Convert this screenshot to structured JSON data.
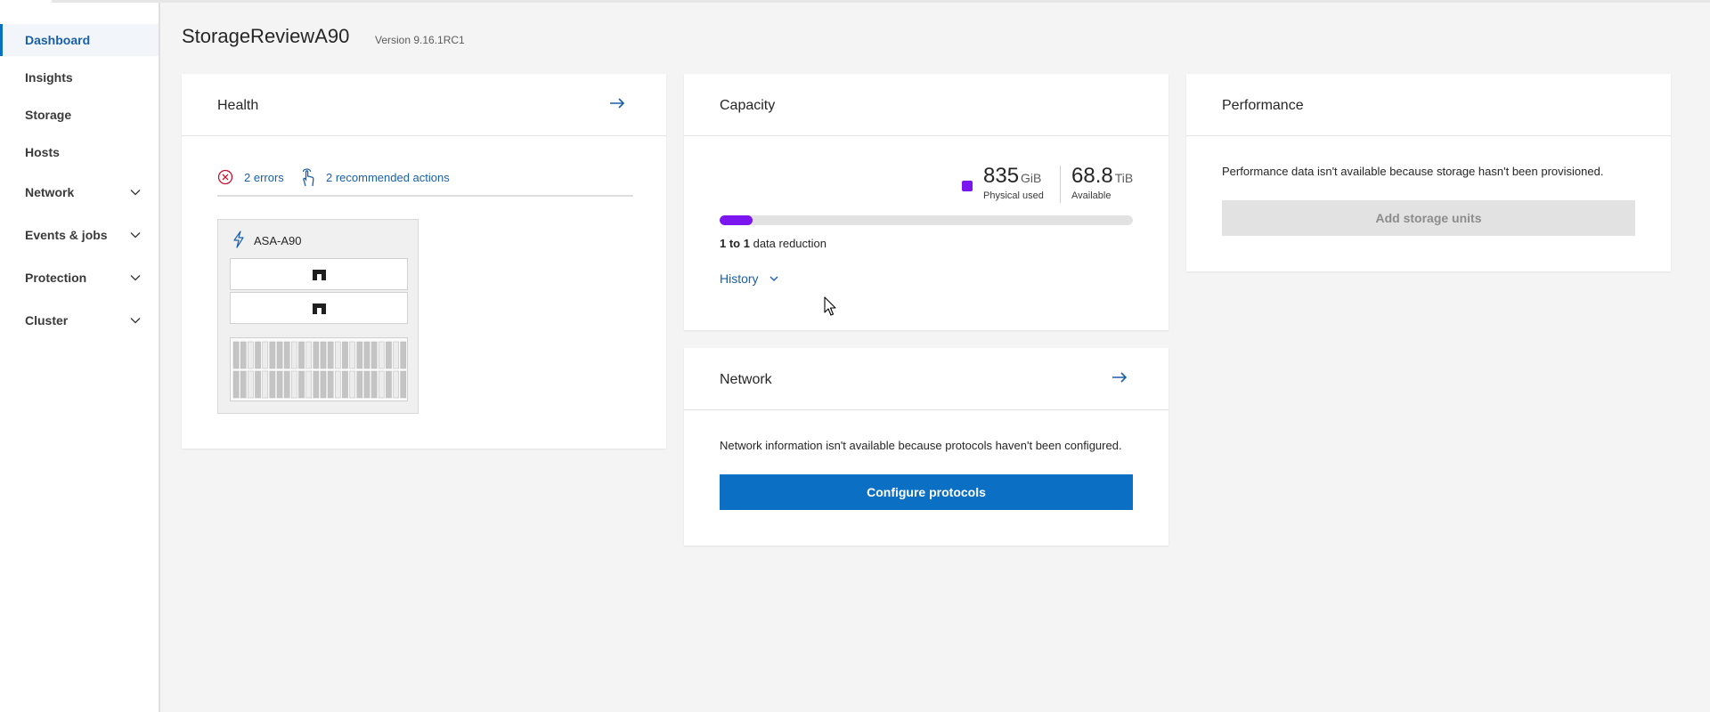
{
  "sidebar": {
    "items": [
      {
        "label": "Dashboard",
        "active": true,
        "expandable": false
      },
      {
        "label": "Insights",
        "active": false,
        "expandable": false
      },
      {
        "label": "Storage",
        "active": false,
        "expandable": false
      },
      {
        "label": "Hosts",
        "active": false,
        "expandable": false
      },
      {
        "label": "Network",
        "active": false,
        "expandable": true
      },
      {
        "label": "Events & jobs",
        "active": false,
        "expandable": true
      },
      {
        "label": "Protection",
        "active": false,
        "expandable": true
      },
      {
        "label": "Cluster",
        "active": false,
        "expandable": true
      }
    ]
  },
  "header": {
    "title": "StorageReviewA90",
    "version": "Version 9.16.1RC1"
  },
  "health": {
    "title": "Health",
    "errors_label": "2 errors",
    "actions_label": "2 recommended actions",
    "device_name": "ASA-A90"
  },
  "capacity": {
    "title": "Capacity",
    "used_value": "835",
    "used_unit": "GiB",
    "used_label": "Physical used",
    "available_value": "68.8",
    "available_unit": "TiB",
    "available_label": "Available",
    "used_fraction": 0.08,
    "reduction_ratio": "1 to 1",
    "reduction_text": "data reduction",
    "history_label": "History"
  },
  "network": {
    "title": "Network",
    "message": "Network information isn't available because protocols haven't been configured.",
    "button_label": "Configure protocols"
  },
  "performance": {
    "title": "Performance",
    "message": "Performance data isn't available because storage hasn't been provisioned.",
    "button_label": "Add storage units"
  },
  "colors": {
    "accent": "#0b6fc4",
    "link": "#1a5fa8",
    "error": "#c8102e",
    "capacity_used": "#7b16f0"
  }
}
